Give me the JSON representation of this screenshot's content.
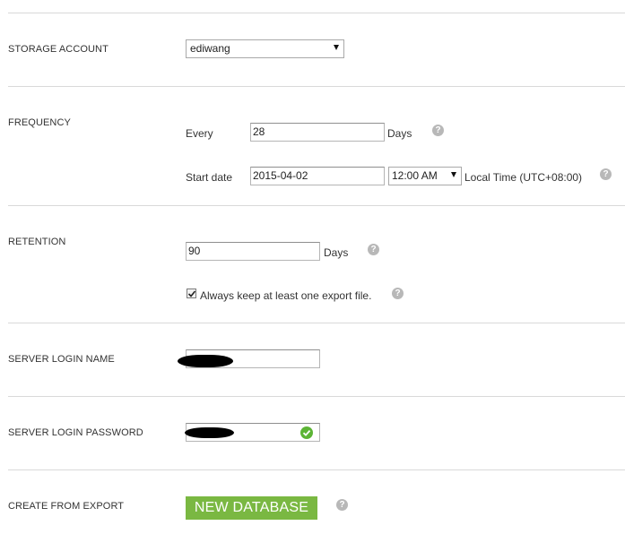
{
  "storage_account": {
    "label": "STORAGE ACCOUNT",
    "selected": "ediwang"
  },
  "frequency": {
    "label": "FREQUENCY",
    "every_label": "Every",
    "every_value": "28",
    "every_unit": "Days",
    "start_date_label": "Start date",
    "start_date_value": "2015-04-02",
    "time_selected": "12:00 AM",
    "timezone_text": "Local Time (UTC+08:00)"
  },
  "retention": {
    "label": "RETENTION",
    "value": "90",
    "unit": "Days",
    "keep_checked": true,
    "keep_label": "Always keep at least one export file."
  },
  "server_login_name": {
    "label": "SERVER LOGIN NAME"
  },
  "server_login_password": {
    "label": "SERVER LOGIN PASSWORD"
  },
  "create_from_export": {
    "label": "CREATE FROM EXPORT",
    "button_label": "NEW DATABASE"
  },
  "help_glyph": "?",
  "colors": {
    "button_green": "#7ab842",
    "check_green": "#5cb435",
    "help_gray": "#b8b8b8"
  },
  "icons": {
    "help": "question-circle-icon",
    "valid": "check-circle-icon",
    "dropdown": "chevron-down-icon"
  }
}
